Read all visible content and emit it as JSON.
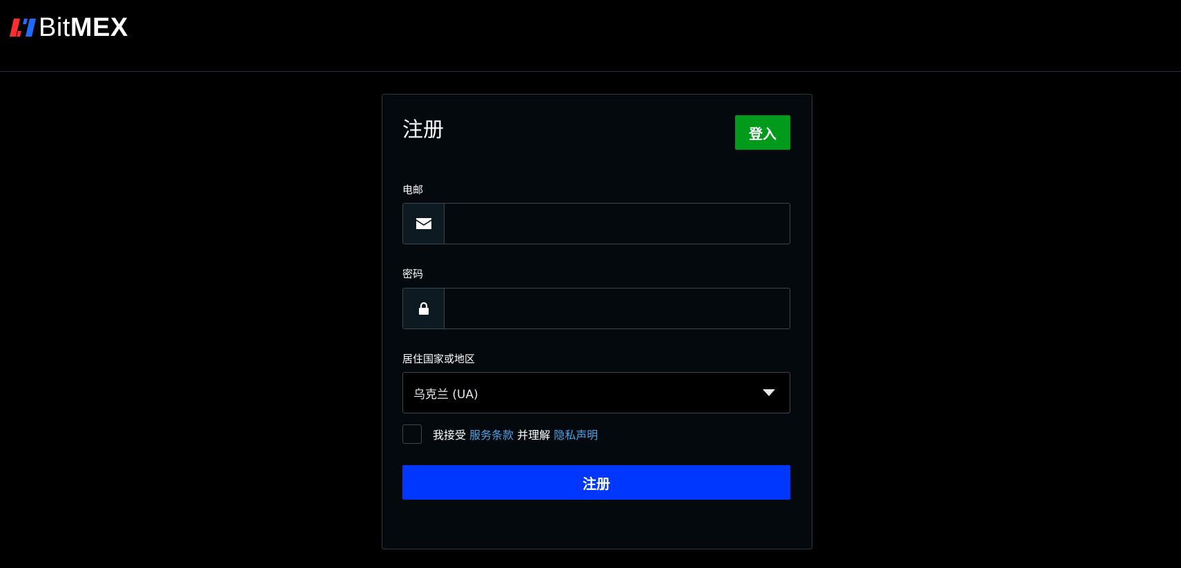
{
  "header": {
    "logo_text_light": "Bit",
    "logo_text_bold": "MEX",
    "logo_colors": {
      "left": "#ff2d2d",
      "right": "#1f6bff"
    }
  },
  "form": {
    "title": "注册",
    "login_button": "登入",
    "email": {
      "label": "电邮",
      "icon": "envelope-icon",
      "value": "",
      "placeholder": ""
    },
    "password": {
      "label": "密码",
      "icon": "lock-icon",
      "value": "",
      "placeholder": ""
    },
    "country": {
      "label": "居住国家或地区",
      "selected": "乌克兰 (UA)",
      "icon": "caret-down-icon"
    },
    "agreement": {
      "checked": false,
      "prefix": "我接受 ",
      "terms_link": "服务条款",
      "middle": " 并理解 ",
      "privacy_link": "隐私声明"
    },
    "submit_button": "注册"
  },
  "colors": {
    "background": "#000000",
    "card": "#03090d",
    "login_green": "#009b1a",
    "submit_blue": "#0037ff",
    "link_blue": "#4aa3e8"
  }
}
